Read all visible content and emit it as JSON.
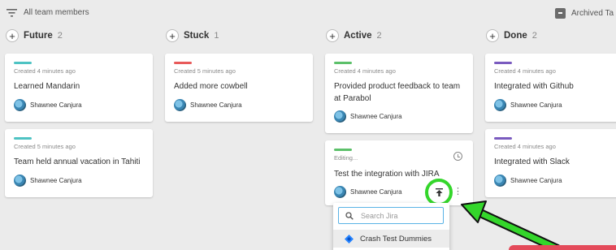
{
  "toolbar": {
    "filter_label": "All team members",
    "archived_label": "Archived Ta"
  },
  "columns": [
    {
      "title": "Future",
      "count": "2",
      "cards": [
        {
          "created": "Created 4 minutes ago",
          "title": "Learned Mandarin",
          "user": "Shawnee Canjura",
          "color": "#4ec3c3"
        },
        {
          "created": "Created 5 minutes ago",
          "title": "Team held annual vacation in Tahiti",
          "user": "Shawnee Canjura",
          "color": "#4ec3c3"
        }
      ]
    },
    {
      "title": "Stuck",
      "count": "1",
      "cards": [
        {
          "created": "Created 5 minutes ago",
          "title": "Added more cowbell",
          "user": "Shawnee Canjura",
          "color": "#e85a5a"
        }
      ]
    },
    {
      "title": "Active",
      "count": "2",
      "cards": [
        {
          "created": "Created 4 minutes ago",
          "title": "Provided product feedback to team at Parabol",
          "user": "Shawnee Canjura",
          "color": "#5cc06a"
        },
        {
          "created": "Editing...",
          "title": "Test the integration with JIRA",
          "user": "Shawnee Canjura",
          "color": "#5cc06a"
        }
      ]
    },
    {
      "title": "Done",
      "count": "2",
      "cards": [
        {
          "created": "Created 4 minutes ago",
          "title": "Integrated with Github",
          "user": "Shawnee Canjura",
          "color": "#7a5bbf"
        },
        {
          "created": "Created 4 minutes ago",
          "title": "Integrated with Slack",
          "user": "Shawnee Canjura",
          "color": "#7a5bbf"
        }
      ]
    }
  ],
  "jira_menu": {
    "search_placeholder": "Search Jira",
    "option": "Crash Test Dummies"
  },
  "colors": {
    "highlight": "#34d62b",
    "accent_blue": "#5ab3e6"
  },
  "icons": [
    "filter-icon",
    "archive-icon",
    "plus-icon",
    "avatar",
    "clock-icon",
    "upload-icon",
    "more-icon",
    "search-icon",
    "jira-icon",
    "arrow-annotation"
  ]
}
